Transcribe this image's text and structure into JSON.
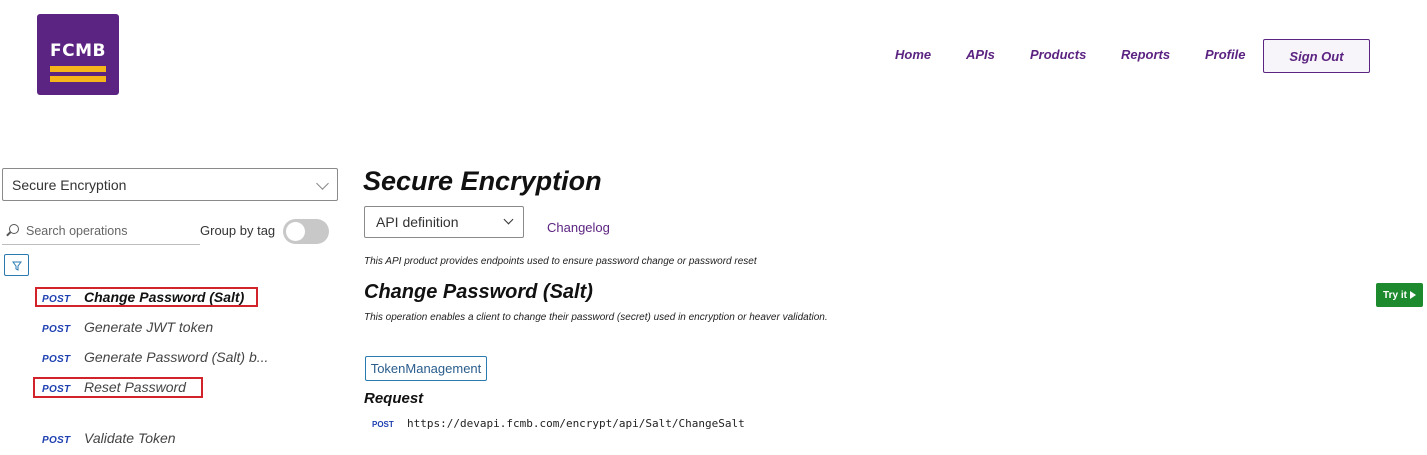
{
  "header": {
    "logo_text": "FCMB",
    "nav": [
      {
        "label": "Home"
      },
      {
        "label": "APIs"
      },
      {
        "label": "Products"
      },
      {
        "label": "Reports"
      },
      {
        "label": "Profile"
      }
    ],
    "sign_out_label": "Sign Out"
  },
  "sidebar": {
    "api_select_value": "Secure Encryption",
    "search_placeholder": "Search operations",
    "group_by_tag_label": "Group by tag",
    "group_by_tag_on": false,
    "operations": [
      {
        "method": "POST",
        "name": "Change Password (Salt)",
        "selected": true,
        "highlighted": true
      },
      {
        "method": "POST",
        "name": "Generate JWT token",
        "selected": false,
        "highlighted": false
      },
      {
        "method": "POST",
        "name": "Generate Password (Salt) b...",
        "selected": false,
        "highlighted": false
      },
      {
        "method": "POST",
        "name": "Reset Password",
        "selected": false,
        "highlighted": true
      },
      {
        "method": "POST",
        "name": "Validate Token",
        "selected": false,
        "highlighted": false
      }
    ]
  },
  "main": {
    "title": "Secure Encryption",
    "definition_select_value": "API definition",
    "changelog_label": "Changelog",
    "api_description": "This API product provides endpoints used to ensure password change or password reset",
    "operation_title": "Change Password (Salt)",
    "operation_description": "This operation enables a client to change their password (secret) used in encryption or heaver validation.",
    "try_it_label": "Try it",
    "tag_label": "TokenManagement",
    "request_title": "Request",
    "request_method": "POST",
    "request_url": "https://devapi.fcmb.com/encrypt/api/Salt/ChangeSalt"
  },
  "colors": {
    "brand_purple": "#5c2482",
    "brand_gold": "#f4b41a",
    "post_blue": "#1d3fb0",
    "try_it_green": "#1e8a2e",
    "highlight_red": "#d3232a"
  }
}
